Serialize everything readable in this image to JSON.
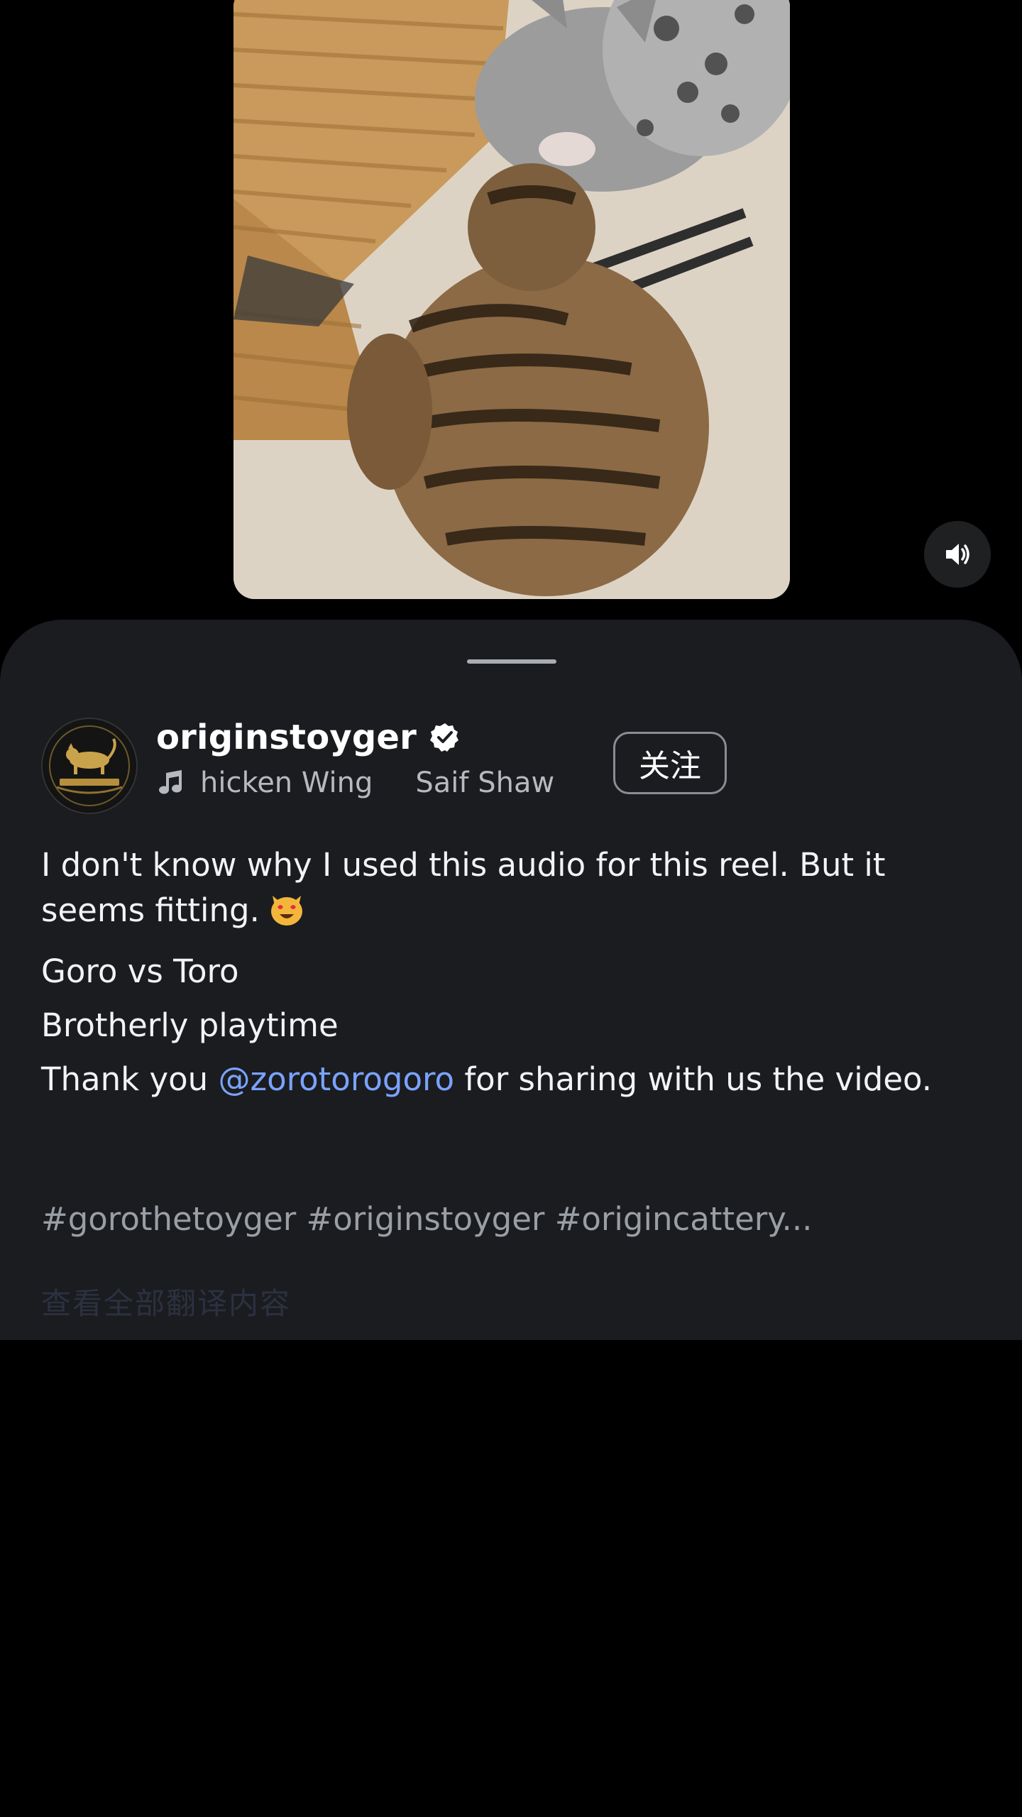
{
  "post": {
    "username": "originstoyger",
    "verified_icon": "verified-badge-icon",
    "audio": {
      "icon": "music-note-icon",
      "title": "hicken Wing",
      "artist": "Saif Shaw"
    },
    "follow_label": "关注",
    "caption_lines": {
      "line1": "I don't know why I used this audio for this reel. But it seems fitting.",
      "line2": "Goro vs Toro",
      "line3": "Brotherly playtime",
      "line4_before": "Thank you ",
      "line4_mention": "@zorotorogoro",
      "line4_after": " for sharing with us the video."
    },
    "hashtags": "#gorothetoyger #originstoyger #origincattery...",
    "faded_text": "查看全部翻译内容"
  },
  "controls": {
    "mute_icon": "volume-icon"
  },
  "colors": {
    "background": "#000000",
    "sheet": "#1b1c20",
    "mention": "#7aa3ff",
    "secondary_text": "#b6b9bf"
  }
}
